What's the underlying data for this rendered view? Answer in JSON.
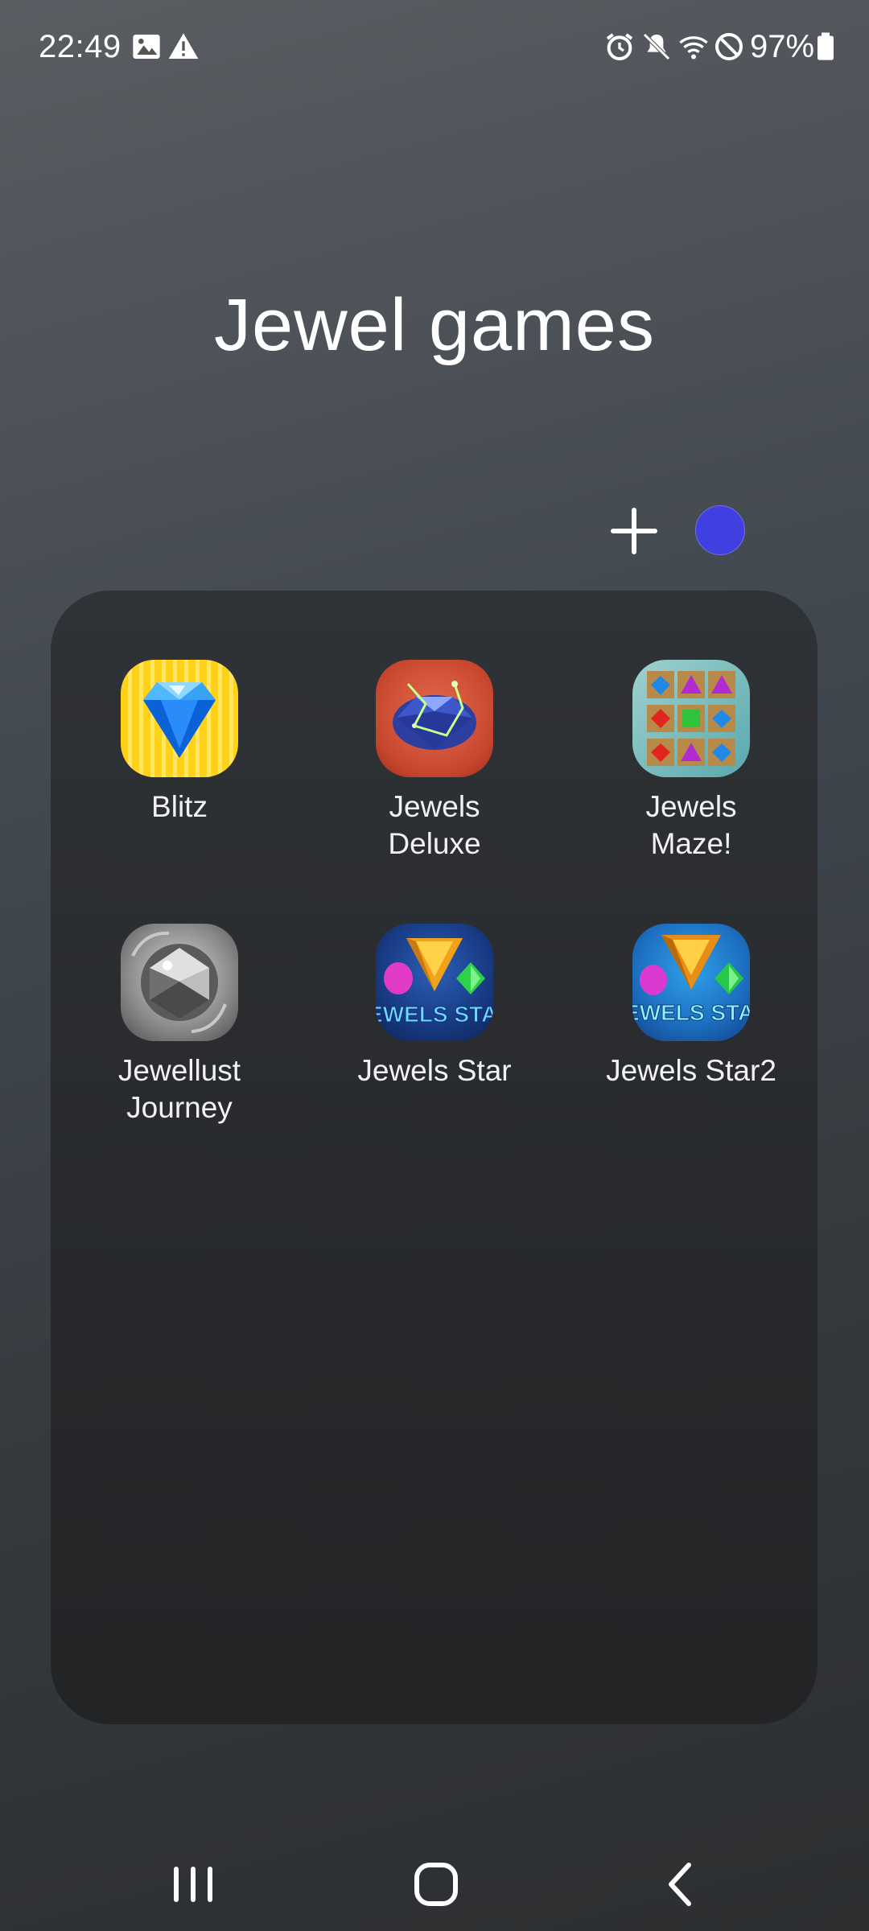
{
  "status_bar": {
    "time": "22:49",
    "battery": "97%",
    "left_icons": [
      "image-icon",
      "warning-icon"
    ],
    "right_icons": [
      "alarm-icon",
      "mute-icon",
      "wifi-icon",
      "do-not-disturb-icon",
      "battery-icon"
    ]
  },
  "folder": {
    "title": "Jewel games",
    "color": "#4040e0",
    "apps": [
      {
        "label": "Blitz",
        "icon": "blitz-diamond-icon"
      },
      {
        "label": "Jewels\nDeluxe",
        "icon": "jewels-deluxe-icon"
      },
      {
        "label": "Jewels\nMaze!",
        "icon": "jewels-maze-icon"
      },
      {
        "label": "Jewellust\nJourney",
        "icon": "jewellust-journey-icon"
      },
      {
        "label": "Jewels Star",
        "icon": "jewels-star-icon"
      },
      {
        "label": "Jewels Star2",
        "icon": "jewels-star2-icon"
      }
    ],
    "icon_text": {
      "jewels_star": "JEWELS STAR",
      "jewels_star2": "JEWELS STAR"
    }
  },
  "nav": [
    "recents-button",
    "home-button",
    "back-button"
  ]
}
